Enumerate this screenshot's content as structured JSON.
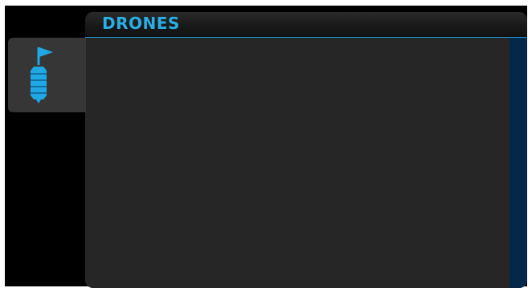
{
  "window": {
    "title": "DRONES"
  },
  "tabs": [
    {
      "icon": "drone-flag-icon",
      "selected": true
    }
  ],
  "colors": {
    "accent": "#2aaee6",
    "panel": "#262626",
    "tab": "#363636",
    "scrollbar": "#04284a",
    "background": "#000000"
  }
}
